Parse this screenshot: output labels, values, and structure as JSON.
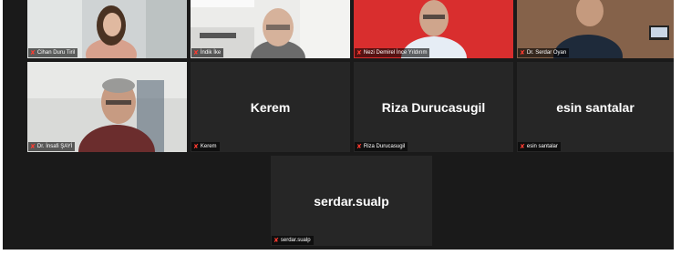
{
  "gallery": {
    "participants": [
      {
        "name": "Cihan Duru Tiril",
        "video": true,
        "muted": true
      },
      {
        "name": "İndik İke",
        "video": true,
        "muted": true
      },
      {
        "name": "Nezi Demirel İnce Yıldırım",
        "video": true,
        "muted": true
      },
      {
        "name": "Dr. Serdar Oyan",
        "video": true,
        "muted": true
      },
      {
        "name": "Dr. İnsafi ŞAYİ",
        "video": true,
        "muted": true
      },
      {
        "name": "Kerem",
        "display": "Kerem",
        "video": false,
        "muted": true
      },
      {
        "name": "Riza Durucasugil",
        "display": "Riza Durucasugil",
        "video": false,
        "muted": true
      },
      {
        "name": "esin santalar",
        "display": "esin santalar",
        "video": false,
        "muted": true
      },
      {
        "name": "serdar.sualp",
        "display": "serdar.sualp",
        "video": false,
        "muted": true
      }
    ],
    "mic_icon": "mic-muted-icon",
    "colors": {
      "background": "#1a1a1a",
      "tile": "#262626",
      "mute": "#ff3b30",
      "red_backdrop": "#d42b2b"
    }
  }
}
